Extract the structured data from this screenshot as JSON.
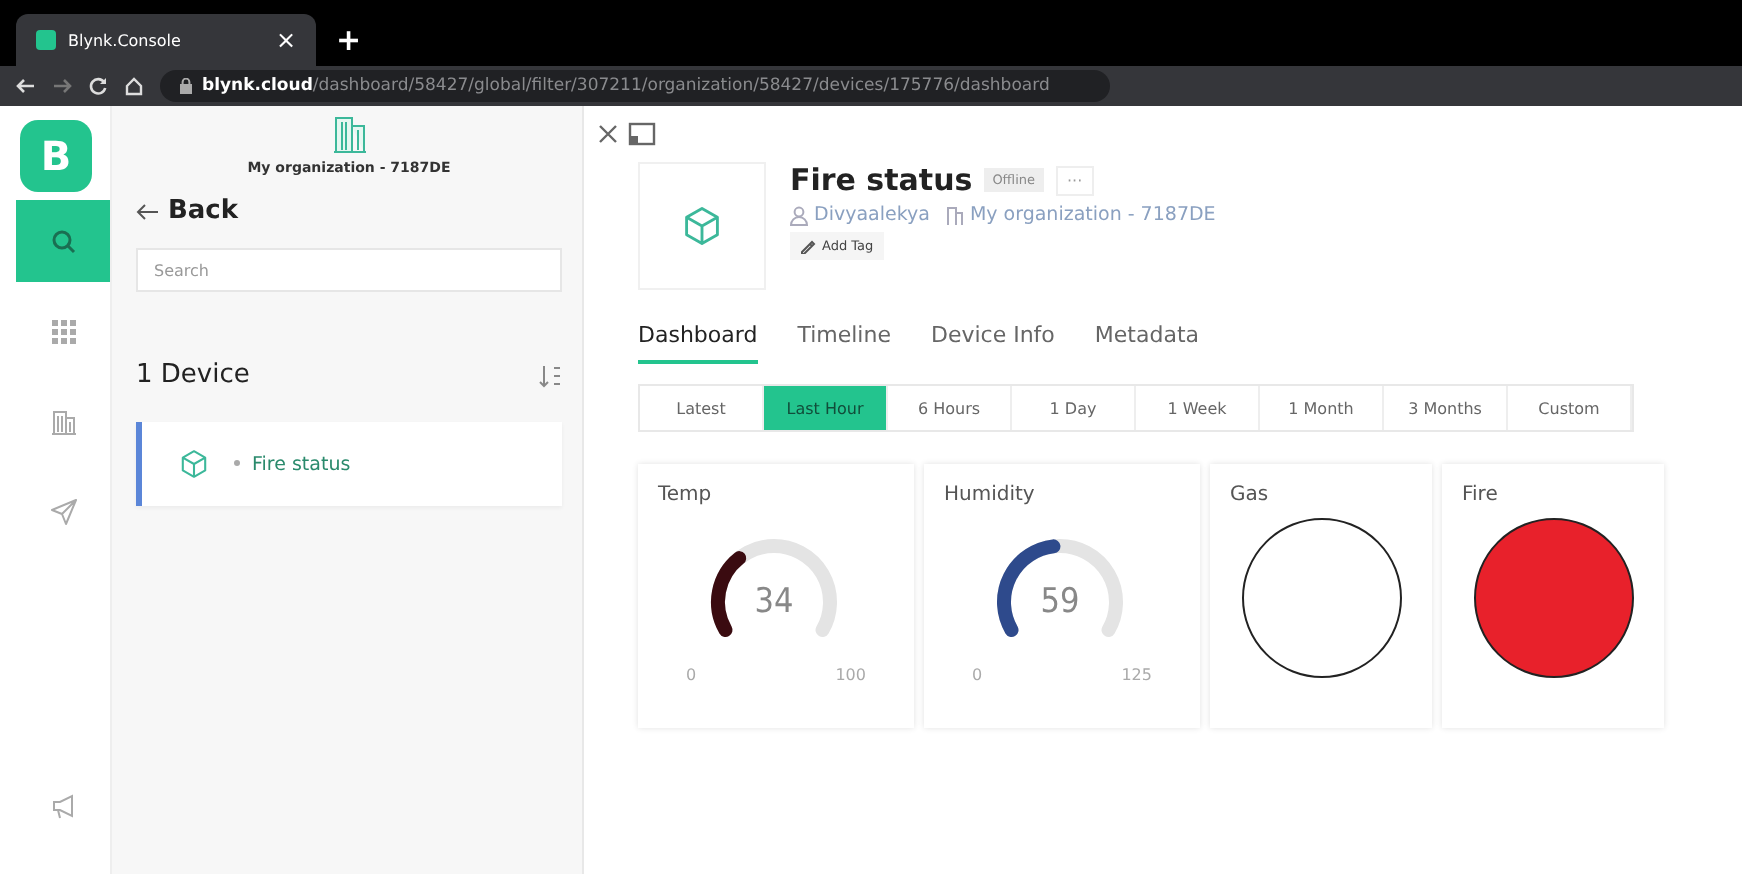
{
  "browser": {
    "tab_title": "Blynk.Console",
    "close": "×",
    "new_tab": "+",
    "url_host": "blynk.cloud",
    "url_path": "/dashboard/58427/global/filter/307211/organization/58427/devices/175776/dashboard"
  },
  "rail": {
    "logo": "B",
    "items": [
      {
        "selected": true
      },
      {
        "selected": false
      },
      {
        "selected": false
      },
      {
        "selected": false
      }
    ]
  },
  "sidebar": {
    "organization": "My organization - 7187DE",
    "back": "Back",
    "search": {
      "placeholder": "Search"
    },
    "count": "1 Device",
    "devices": [
      {
        "name": "Fire status",
        "selected": true
      }
    ]
  },
  "device": {
    "name": "Fire status",
    "status": "Offline",
    "more": "···",
    "owner": "Divyaalekya",
    "organization": "My organization - 7187DE",
    "add_tag": "Add Tag"
  },
  "tabs": [
    {
      "label": "Dashboard",
      "selected": true
    },
    {
      "label": "Timeline",
      "selected": false
    },
    {
      "label": "Device Info",
      "selected": false
    },
    {
      "label": "Metadata",
      "selected": false
    }
  ],
  "ranges": [
    {
      "label": "Latest",
      "selected": false
    },
    {
      "label": "Last Hour",
      "selected": true
    },
    {
      "label": "6 Hours",
      "selected": false
    },
    {
      "label": "1 Day",
      "selected": false
    },
    {
      "label": "1 Week",
      "selected": false
    },
    {
      "label": "1 Month",
      "selected": false
    },
    {
      "label": "3 Months",
      "selected": false
    },
    {
      "label": "Custom",
      "selected": false
    }
  ],
  "widgets": [
    {
      "kind": "gauge",
      "title": "Temp",
      "value": "34",
      "min": "0",
      "max": "100",
      "color": "#3a0b10"
    },
    {
      "kind": "gauge",
      "title": "Humidity",
      "value": "59",
      "min": "0",
      "max": "125",
      "color": "#2e4a8c"
    },
    {
      "kind": "led",
      "title": "Gas",
      "on": false
    },
    {
      "kind": "led",
      "title": "Fire",
      "on": true,
      "color": "#e8212b"
    }
  ]
}
